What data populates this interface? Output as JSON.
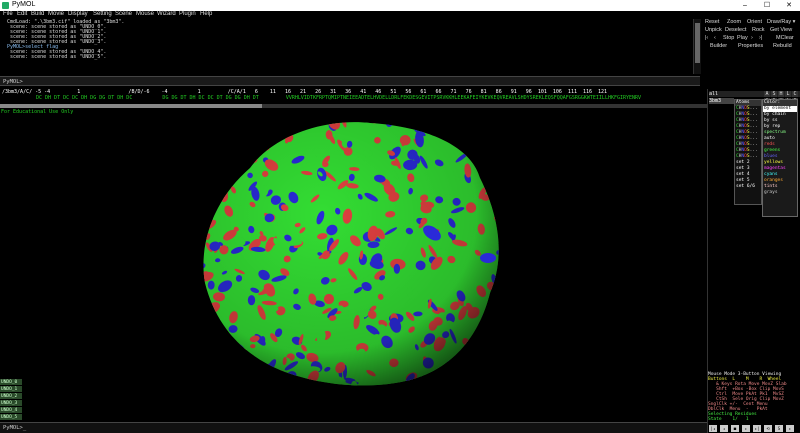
{
  "window": {
    "title": "PyMOL",
    "minimize": "–",
    "maximize": "☐",
    "close": "✕"
  },
  "menu": [
    "File",
    "Edit",
    "Build",
    "Movie",
    "Display",
    "Setting",
    "Scene",
    "Mouse",
    "Wizard",
    "Plugin",
    "Help"
  ],
  "console": {
    "lines": [
      {
        "text": " CmdLoad: \".\\3bm3.cif\" loaded as \"3bm3\".",
        "cmd": false
      },
      {
        "text": "  scene: scene stored as \"UNDO_0\".",
        "cmd": false
      },
      {
        "text": "  scene: scene stored as \"UNDO_1\".",
        "cmd": false
      },
      {
        "text": "  scene: scene stored as \"UNDO_2\".",
        "cmd": false
      },
      {
        "text": "  scene: scene stored as \"UNDO_3\".",
        "cmd": false
      },
      {
        "text": " PyMOL>select flag",
        "cmd": true
      },
      {
        "text": "  scene: scene stored as \"UNDO_4\".",
        "cmd": false
      },
      {
        "text": "  scene: scene stored as \"UNDO_5\".",
        "cmd": false
      }
    ]
  },
  "controls": {
    "row1": [
      "Reset",
      "Zoom",
      "Orient",
      "Draw/Ray ▾"
    ],
    "row2": [
      "Unpick",
      "Deselect",
      "Rock",
      "Get View"
    ],
    "row3": [
      "|‹",
      "‹",
      "Stop",
      "Play",
      "›",
      "›|",
      "MClear"
    ],
    "row4": [
      "Builder",
      "Properties",
      "Rebuild"
    ]
  },
  "prompt_top": "PyMOL>",
  "sequence": {
    "header": "/3bm3/A/C/ -5 -4         1                /B/D/-6    -4          1         /C/A/1   6    11   16   21   26   31   36   41   46   51   56   61   66   71   76   81   86   91   96  101  106  111  116  121",
    "residues": "DC DH DT DC DC DH DG DG DT DH DC          DG DG DT DH DC DC DT DG DG DH DT         VVRHLVIDTKFRPTQMIPTNEIEEADTELHVDELLDRLFEKDESGEVITPSRVKKHLEEKAFEIYKEVKEQVREAVLSHDYSREKLEQSFQQAFGSRGGKWTEIILLHKFGIRYENRV"
  },
  "edu_notice": "For Educational Use Only",
  "scenes": [
    "UNDO_0",
    "UNDO_1",
    "UNDO_2",
    "UNDO_3",
    "UNDO_4",
    "UNDO_5"
  ],
  "prompt_bottom": "PyMOL>_",
  "objects": {
    "all_label": "all",
    "item": "3bm3",
    "buttons": [
      "A",
      "S",
      "H",
      "L",
      "C"
    ]
  },
  "atoms_menu": {
    "title": "Atoms",
    "items": [
      "CHNOS...",
      "CHNOS...",
      "CHNOS...",
      "CHNOS...",
      "CHNOS...",
      "CHNOS...",
      "CHNOS...",
      "CHNOS...",
      "CHNOS...",
      "set 2",
      "set 3",
      "set 4",
      "set 5",
      "set 6/6"
    ]
  },
  "color_menu": {
    "title": "Color:",
    "items": [
      {
        "label": "by element",
        "color": "#ffffff",
        "sel": true
      },
      {
        "label": "by chain",
        "color": "#ffffff"
      },
      {
        "label": "by ss",
        "color": "#ffffff"
      },
      {
        "label": "by rep",
        "color": "#ffffff"
      },
      {
        "label": "spectrum",
        "color": "#88ff88"
      },
      {
        "label": "auto",
        "color": "#ffffff"
      },
      {
        "label": "reds",
        "color": "#ff5555"
      },
      {
        "label": "greens",
        "color": "#44ff44"
      },
      {
        "label": "blues",
        "color": "#6666ff"
      },
      {
        "label": "yellows",
        "color": "#ffff44"
      },
      {
        "label": "magentas",
        "color": "#ff44ff"
      },
      {
        "label": "cyans",
        "color": "#44ffff"
      },
      {
        "label": "oranges",
        "color": "#ffaa33"
      },
      {
        "label": "tints",
        "color": "#ffcccc"
      },
      {
        "label": "grays",
        "color": "#cccccc"
      }
    ]
  },
  "mouse": {
    "title": "Mouse Mode 3-Button Viewing",
    "lines": [
      "Buttons  L    M    R  Wheel",
      "   & Keys Rota Move MovZ Slab",
      "   Shft  +Box -Box Clip MovS",
      "   Ctrl  Move PkAt Pk1  MvSZ",
      "   CtSh  Sele Orig Clip MovZ",
      "SnglClk +/-  Cent Menu",
      "DblClk  Menu  -   PkAt",
      "Selecting Residues",
      "State    1/   1"
    ]
  },
  "playbar": [
    "|◂",
    "◂",
    "■",
    "▸",
    "▸|",
    "⟲",
    "S",
    "▸"
  ],
  "colors": {
    "accent_green": "#22cc22",
    "surface_green": "#33dd33",
    "surface_red": "#e04040",
    "surface_blue": "#2a2ad8"
  }
}
